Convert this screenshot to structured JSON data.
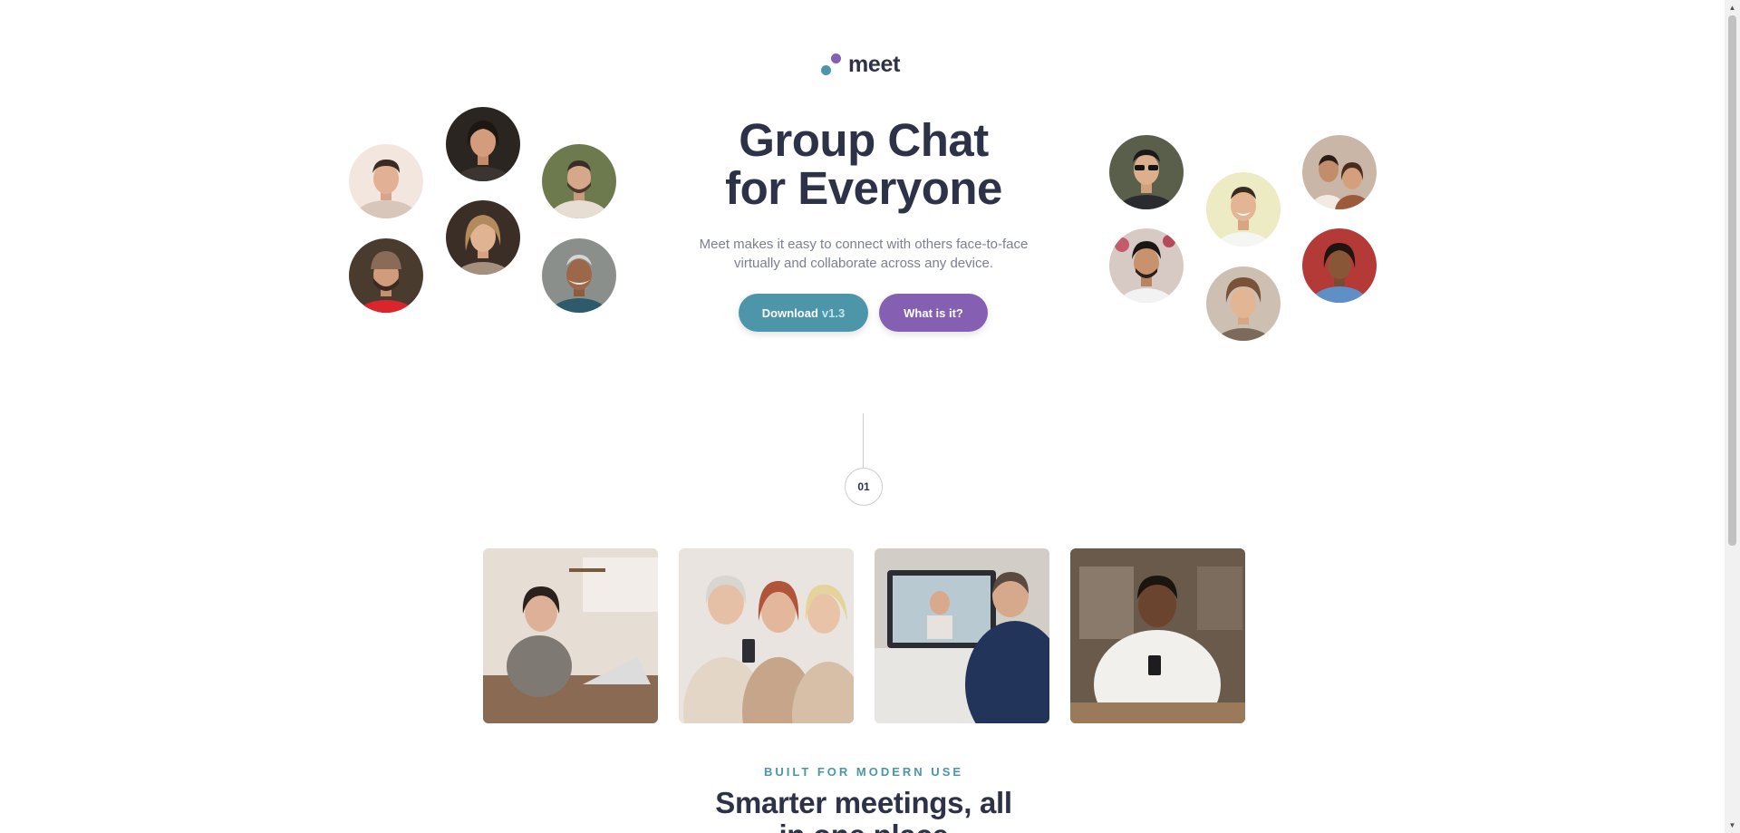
{
  "brand": {
    "name": "meet",
    "color_primary": "#4d96a9",
    "color_secondary": "#855fb1",
    "color_dark": "#2d3248"
  },
  "hero": {
    "title_line1": "Group Chat",
    "title_line2": "for Everyone",
    "subtitle_line1": "Meet makes it easy to connect with others face-to-face",
    "subtitle_line2": "virtually and collaborate across any device.",
    "download_label": "Download",
    "download_version": "v1.3",
    "what_label": "What is it?"
  },
  "avatars_left": [
    {
      "name": "avatar-man-light-sweater"
    },
    {
      "name": "avatar-woman-dark-hair"
    },
    {
      "name": "avatar-man-beard-jacket"
    },
    {
      "name": "avatar-man-beanie"
    },
    {
      "name": "avatar-woman-blonde-smiling"
    },
    {
      "name": "avatar-older-man"
    }
  ],
  "avatars_right": [
    {
      "name": "avatar-man-sunglasses"
    },
    {
      "name": "avatar-man-yellow-bg"
    },
    {
      "name": "avatar-couple"
    },
    {
      "name": "avatar-man-flowers"
    },
    {
      "name": "avatar-man-curly-hair"
    },
    {
      "name": "avatar-woman-denim"
    }
  ],
  "step": {
    "number": "01"
  },
  "photos": [
    {
      "name": "photo-woman-laptop"
    },
    {
      "name": "photo-women-phone"
    },
    {
      "name": "photo-video-call"
    },
    {
      "name": "photo-man-phone"
    }
  ],
  "features": {
    "eyebrow": "BUILT FOR MODERN USE",
    "title_line1": "Smarter meetings, all",
    "title_line2": "in one place"
  }
}
